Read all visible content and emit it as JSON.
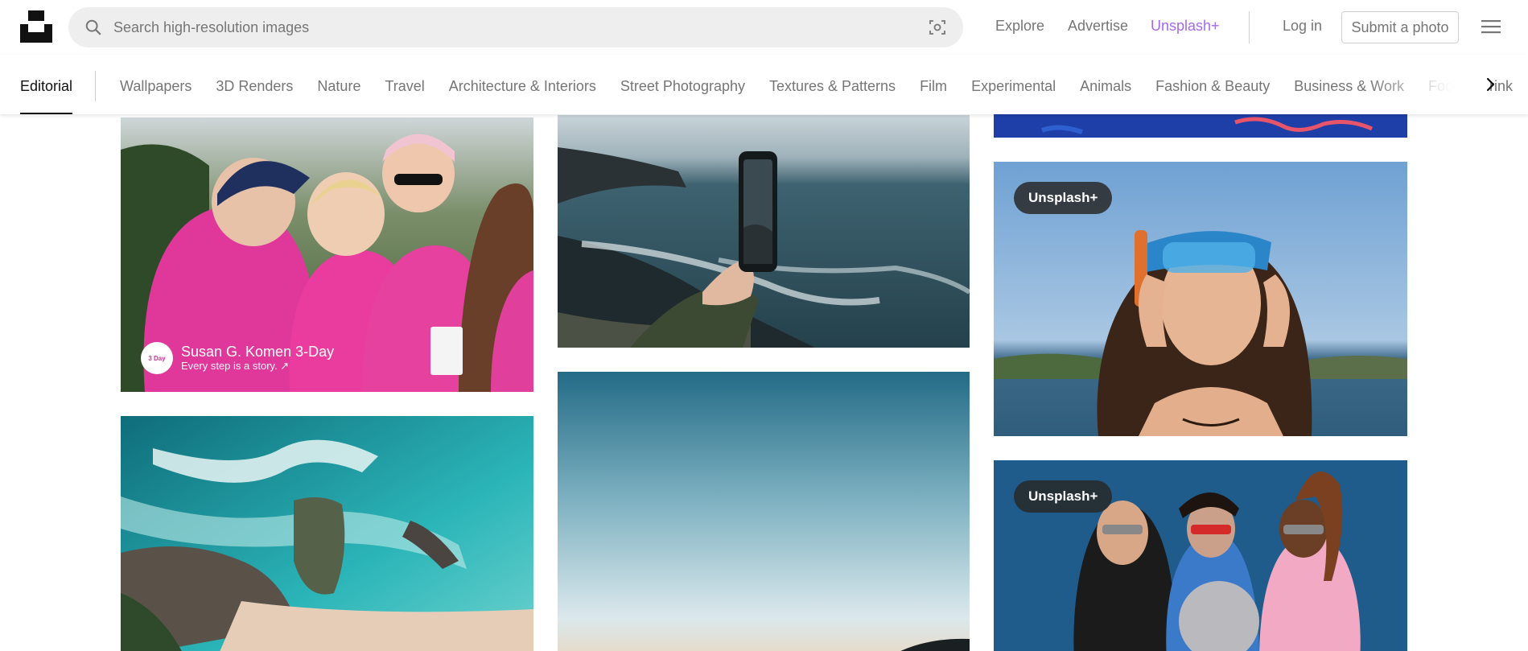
{
  "header": {
    "search_placeholder": "Search high-resolution images",
    "nav": {
      "explore": "Explore",
      "advertise": "Advertise",
      "unsplash_plus": "Unsplash+"
    },
    "login": "Log in",
    "submit": "Submit a photo"
  },
  "topics": {
    "active": "Editorial",
    "items": [
      "Wallpapers",
      "3D Renders",
      "Nature",
      "Travel",
      "Architecture & Interiors",
      "Street Photography",
      "Textures & Patterns",
      "Film",
      "Experimental",
      "Animals",
      "Fashion & Beauty",
      "Business & Work",
      "Food & Drink"
    ]
  },
  "photos": {
    "walkers": {
      "sponsor_name": "Susan G. Komen 3-Day",
      "sponsor_tagline": "Every step is a story. ↗",
      "avatar_text": "3 Day"
    },
    "snorkel": {
      "badge": "Unsplash+"
    },
    "trio": {
      "badge": "Unsplash+"
    }
  },
  "colors": {
    "accent_plus": "#a36af0",
    "muted_text": "#767676"
  }
}
